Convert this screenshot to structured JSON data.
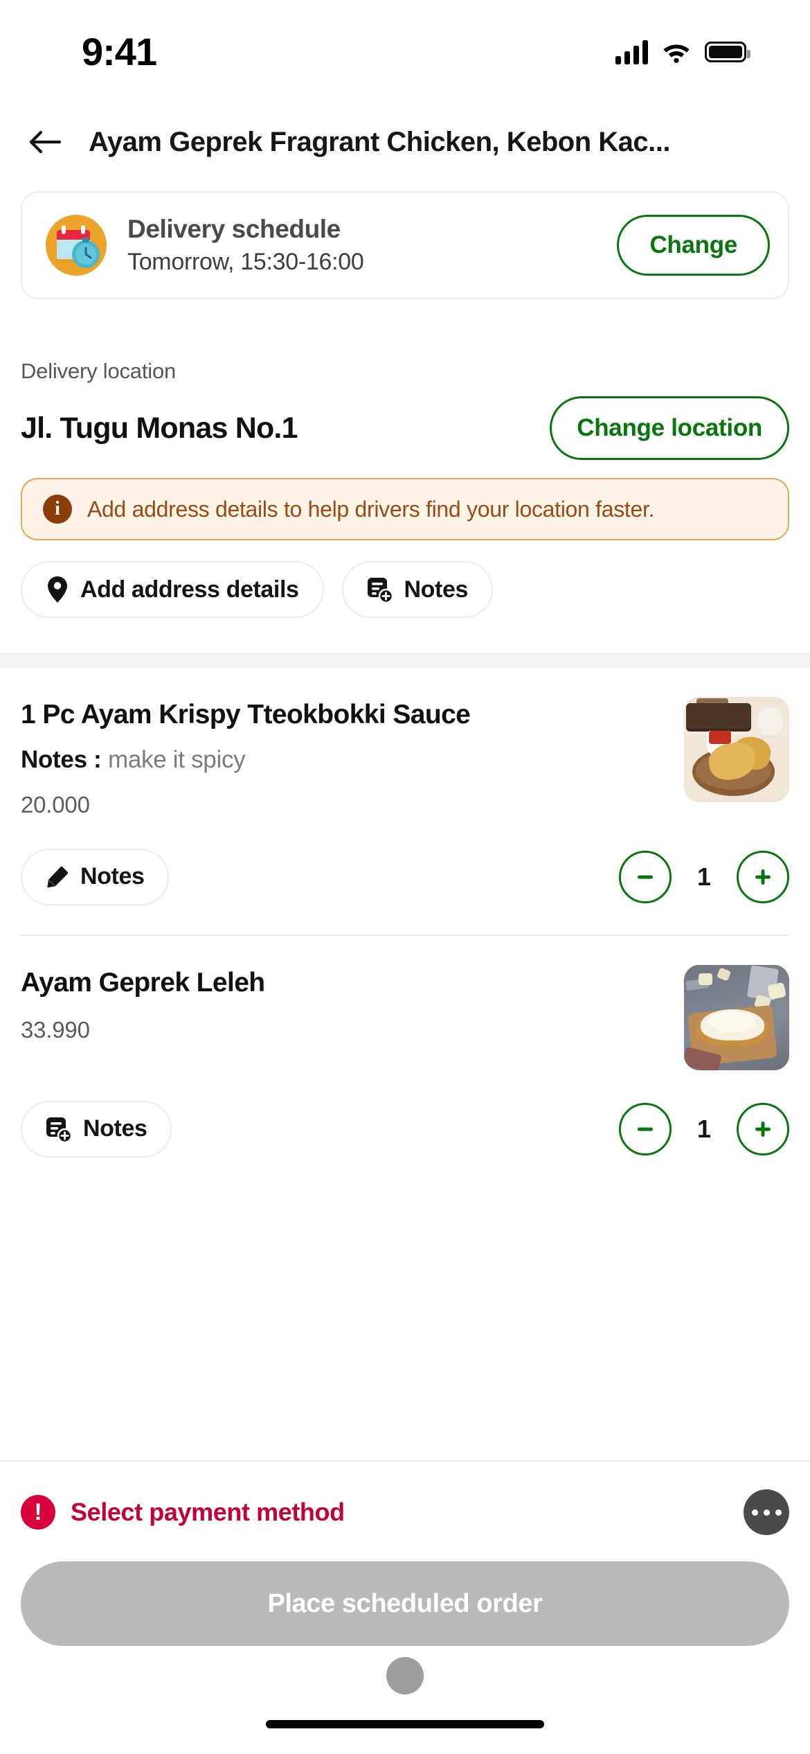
{
  "status_bar": {
    "time": "9:41",
    "signal_icon": "cellular-signal-icon",
    "wifi_icon": "wifi-icon",
    "battery_icon": "battery-full-icon"
  },
  "header": {
    "back_icon": "back-arrow-icon",
    "title": "Ayam Geprek Fragrant Chicken, Kebon Kac..."
  },
  "delivery_schedule": {
    "icon": "calendar-clock-icon",
    "title": "Delivery schedule",
    "subtitle": "Tomorrow, 15:30-16:00",
    "change_label": "Change"
  },
  "delivery_location": {
    "label": "Delivery location",
    "address": "Jl. Tugu Monas No.1",
    "change_label": "Change location",
    "warning": {
      "icon": "info-icon",
      "text": "Add address details to help drivers find your location faster."
    },
    "chips": [
      {
        "icon": "map-pin-icon",
        "label": "Add address details"
      },
      {
        "icon": "note-add-icon",
        "label": "Notes"
      }
    ]
  },
  "cart": {
    "items": [
      {
        "name": "1 Pc Ayam Krispy Tteokbokki Sauce",
        "notes_label": "Notes :",
        "notes_value": "make it spicy",
        "price": "20.000",
        "notes_button_label": "Notes",
        "notes_button_icon": "pencil-icon",
        "quantity": "1",
        "decrease_icon": "minus-icon",
        "increase_icon": "plus-icon",
        "thumbnail": "fried-chicken-photo"
      },
      {
        "name": "Ayam Geprek Leleh",
        "notes_label": "",
        "notes_value": "",
        "price": "33.990",
        "notes_button_label": "Notes",
        "notes_button_icon": "note-add-icon",
        "quantity": "1",
        "decrease_icon": "minus-icon",
        "increase_icon": "plus-icon",
        "thumbnail": "melted-cheese-chicken-photo"
      }
    ]
  },
  "payment": {
    "alert_icon": "alert-exclamation-icon",
    "text": "Select payment method",
    "more_icon": "more-options-icon"
  },
  "cta": {
    "label": "Place scheduled order",
    "enabled": false
  },
  "colors": {
    "brand_green": "#09750F",
    "alert_red": "#C30039",
    "warning_border": "#E0A95C",
    "warning_bg": "#FDF3E7",
    "warning_text": "#9B4A16",
    "cta_disabled": "#B9B9B9"
  }
}
